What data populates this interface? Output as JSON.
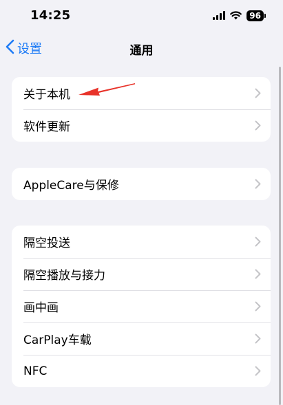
{
  "status_bar": {
    "time": "14:25",
    "battery_level": "96"
  },
  "nav": {
    "back_label": "设置",
    "title": "通用"
  },
  "groups": [
    {
      "items": [
        {
          "label": "关于本机"
        },
        {
          "label": "软件更新"
        }
      ]
    },
    {
      "items": [
        {
          "label": "AppleCare与保修"
        }
      ]
    },
    {
      "items": [
        {
          "label": "隔空投送"
        },
        {
          "label": "隔空播放与接力"
        },
        {
          "label": "画中画"
        },
        {
          "label": "CarPlay车载"
        },
        {
          "label": "NFC"
        }
      ]
    }
  ],
  "colors": {
    "accent": "#1f7cf6",
    "background": "#f2f2f7",
    "annotation": "#e8332a",
    "chevron": "#c4c4c7"
  },
  "icons": {
    "back": "chevron-left-icon",
    "row": "chevron-right-icon",
    "signal": "cellular-signal-icon",
    "wifi": "wifi-icon",
    "battery": "battery-icon",
    "annotation": "red-arrow-icon"
  }
}
